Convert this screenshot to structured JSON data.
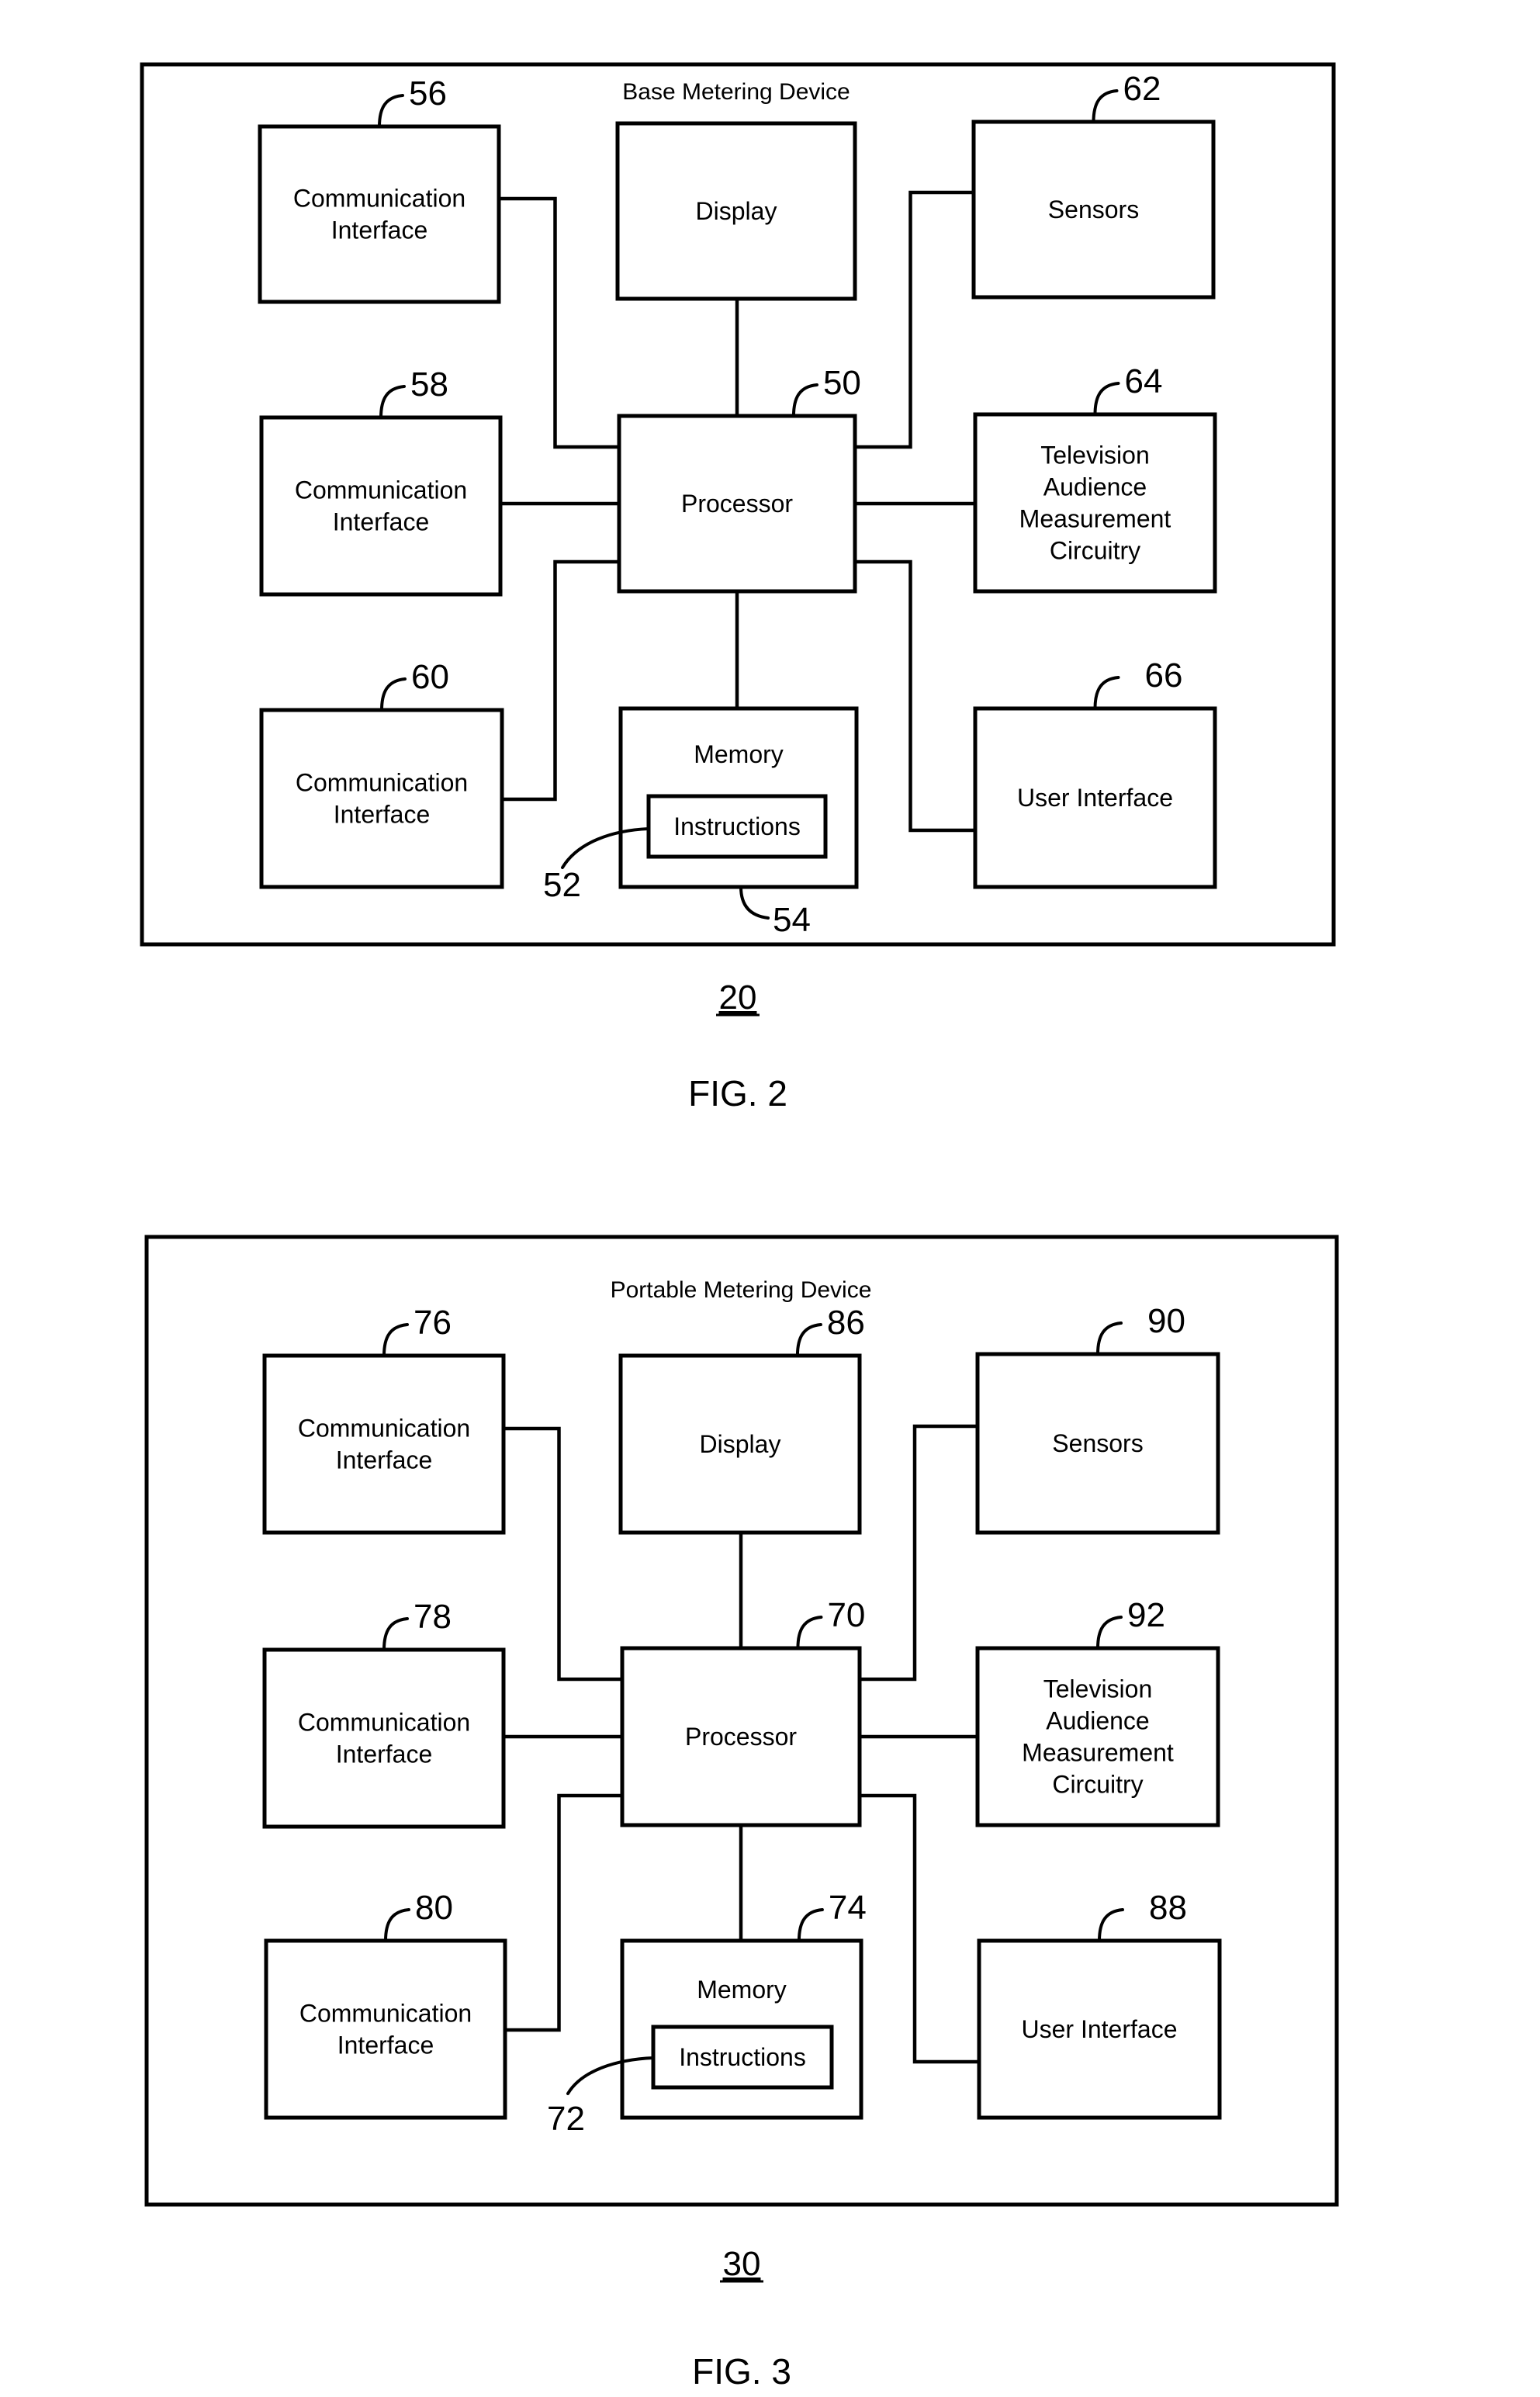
{
  "figures": [
    {
      "caption": "FIG. 2",
      "figure_number": "20",
      "title": "Base Metering Device",
      "blocks": {
        "comm1": {
          "lines": [
            "Communication",
            "Interface"
          ],
          "ref": "56"
        },
        "display": {
          "lines": [
            "Display"
          ],
          "ref": ""
        },
        "sensors": {
          "lines": [
            "Sensors"
          ],
          "ref": "62"
        },
        "comm2": {
          "lines": [
            "Communication",
            "Interface"
          ],
          "ref": "58"
        },
        "processor": {
          "lines": [
            "Processor"
          ],
          "ref": "50"
        },
        "tv": {
          "lines": [
            "Television",
            "Audience",
            "Measurement",
            "Circuitry"
          ],
          "ref": "64"
        },
        "comm3": {
          "lines": [
            "Communication",
            "Interface"
          ],
          "ref": "60"
        },
        "memory": {
          "lines": [
            "Memory"
          ],
          "ref": "54"
        },
        "instructions": {
          "lines": [
            "Instructions"
          ],
          "ref": "52"
        },
        "ui": {
          "lines": [
            "User Interface"
          ],
          "ref": "66"
        }
      }
    },
    {
      "caption": "FIG. 3",
      "figure_number": "30",
      "title": "Portable Metering Device",
      "blocks": {
        "comm1": {
          "lines": [
            "Communication",
            "Interface"
          ],
          "ref": "76"
        },
        "display": {
          "lines": [
            "Display"
          ],
          "ref": "86"
        },
        "sensors": {
          "lines": [
            "Sensors"
          ],
          "ref": "90"
        },
        "comm2": {
          "lines": [
            "Communication",
            "Interface"
          ],
          "ref": "78"
        },
        "processor": {
          "lines": [
            "Processor"
          ],
          "ref": "70"
        },
        "tv": {
          "lines": [
            "Television",
            "Audience",
            "Measurement",
            "Circuitry"
          ],
          "ref": "92"
        },
        "comm3": {
          "lines": [
            "Communication",
            "Interface"
          ],
          "ref": "80"
        },
        "memory": {
          "lines": [
            "Memory"
          ],
          "ref": "74"
        },
        "instructions": {
          "lines": [
            "Instructions"
          ],
          "ref": "72"
        },
        "ui": {
          "lines": [
            "User Interface"
          ],
          "ref": "88"
        }
      }
    }
  ]
}
